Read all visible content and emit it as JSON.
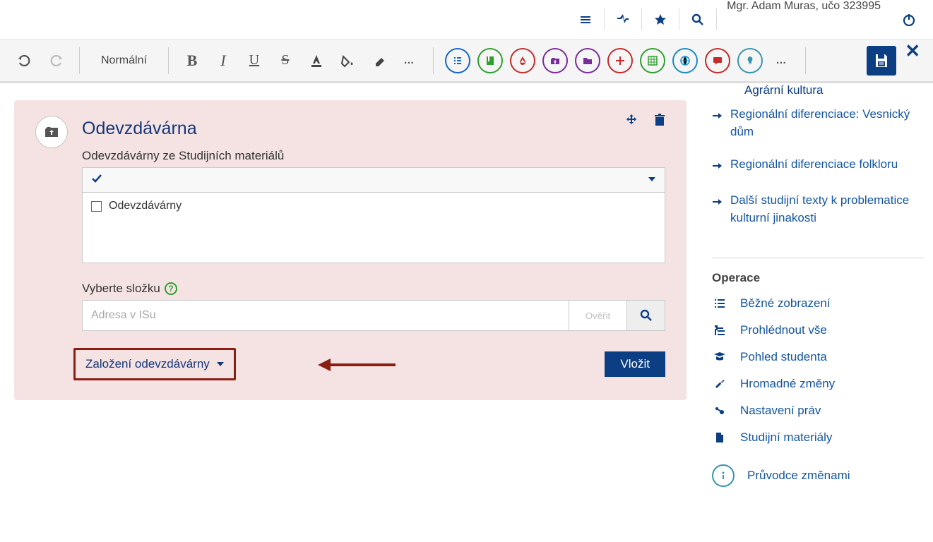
{
  "header": {
    "user": "Mgr. Adam Muras, učo 323995"
  },
  "toolbar": {
    "style_label": "Normální"
  },
  "panel": {
    "title": "Odevzdávárna",
    "list_label": "Odevzdávárny ze Studijních materiálů",
    "list_item": "Odevzdávárny",
    "folder_label": "Vyberte složku",
    "addr_placeholder": "Adresa v ISu",
    "verify_label": "Ověřit",
    "create_dd": "Založení odevzdávárny",
    "insert_label": "Vložit"
  },
  "sidebar": {
    "cut_link": "Agrární kultura",
    "links": [
      "Regionální diferenciace: Vesnický dům",
      "Regionální diferenciace folkloru",
      "Další studijní texty k problematice kulturní jinakosti"
    ],
    "ops_heading": "Operace",
    "ops": [
      "Běžné zobrazení",
      "Prohlédnout vše",
      "Pohled studenta",
      "Hromadné změny",
      "Nastavení práv",
      "Studijní materiály"
    ],
    "guide": "Průvodce změnami"
  }
}
